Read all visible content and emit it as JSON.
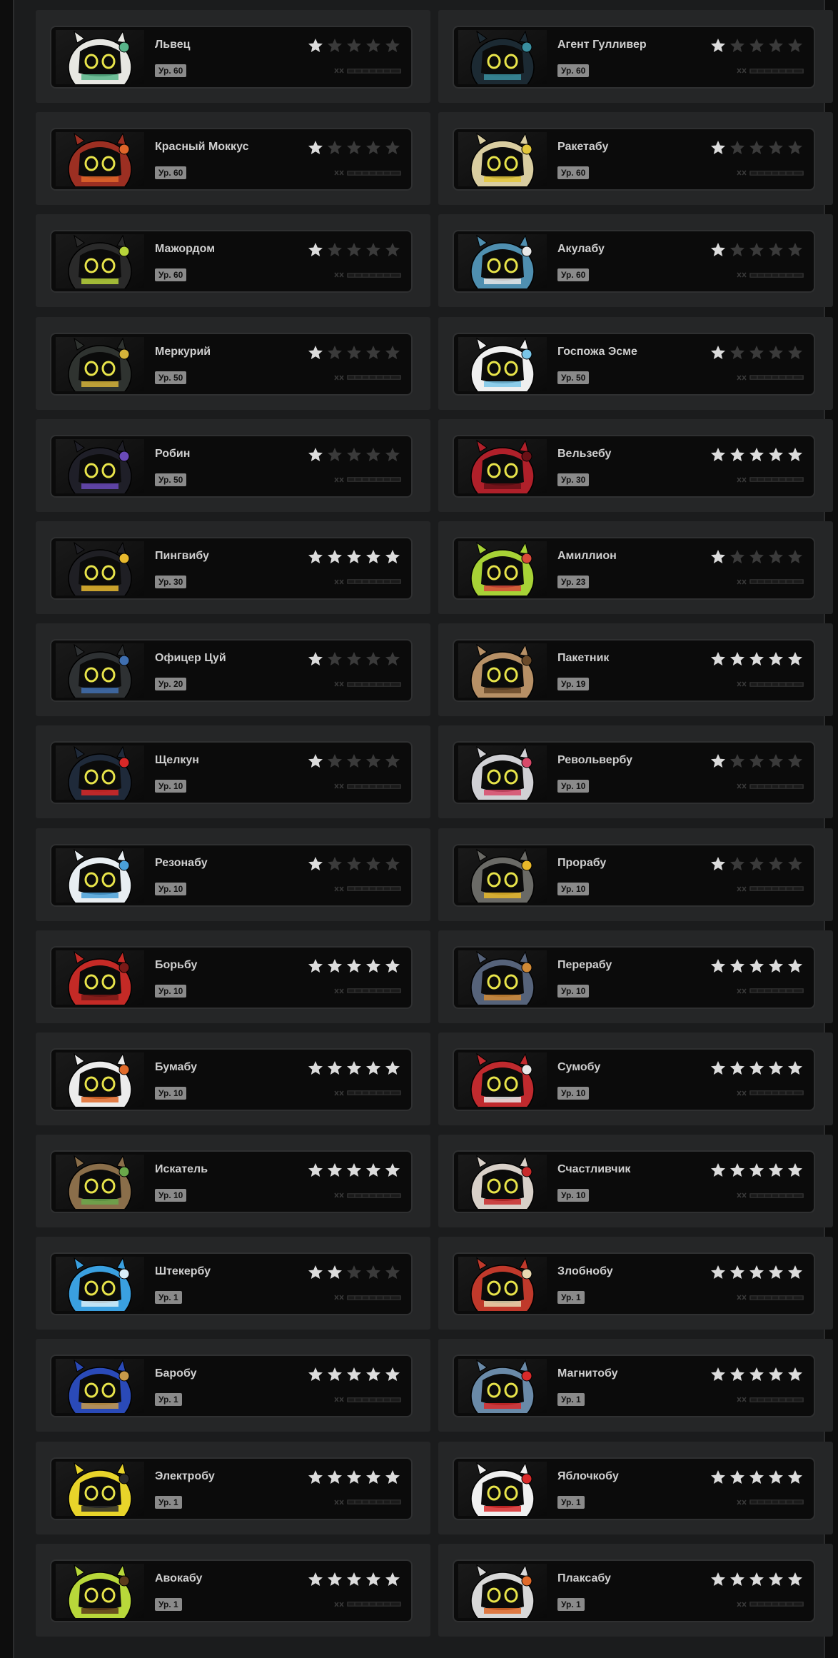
{
  "colors": {
    "background": "#0d0d0d",
    "panel": "#1b1c1d",
    "cell": "#252627",
    "card": "#0b0b0b",
    "star_filled": "#dcdcdc",
    "star_empty": "#3a3a3a",
    "level_badge": "#8a8a8a",
    "name_text": "#cfcfcf"
  },
  "bangboos": [
    {
      "name": "Львец",
      "level": "Ур. 60",
      "stars": 1,
      "icon": "bangboo-portrait-lvets",
      "body": "#e7e7e2",
      "accent": "#58b58a"
    },
    {
      "name": "Агент Гулливер",
      "level": "Ур. 60",
      "stars": 1,
      "icon": "bangboo-portrait-agent-gulliver",
      "body": "#1c2a33",
      "accent": "#3a8fa0"
    },
    {
      "name": "Красный Моккус",
      "level": "Ур. 60",
      "stars": 1,
      "icon": "bangboo-portrait-red-mokkus",
      "body": "#9c2f22",
      "accent": "#e0662a"
    },
    {
      "name": "Ракетабу",
      "level": "Ур. 60",
      "stars": 1,
      "icon": "bangboo-portrait-raketabu",
      "body": "#d9cda0",
      "accent": "#e2c63b"
    },
    {
      "name": "Мажордом",
      "level": "Ур. 60",
      "stars": 1,
      "icon": "bangboo-portrait-mazhordom",
      "body": "#2a2a2a",
      "accent": "#b7d43a"
    },
    {
      "name": "Акулабу",
      "level": "Ур. 60",
      "stars": 1,
      "icon": "bangboo-portrait-akulabu",
      "body": "#4f8fb0",
      "accent": "#e8e8e8"
    },
    {
      "name": "Меркурий",
      "level": "Ур. 50",
      "stars": 1,
      "icon": "bangboo-portrait-merkuriy",
      "body": "#2f3330",
      "accent": "#d6b43a"
    },
    {
      "name": "Госпожа Эсме",
      "level": "Ур. 50",
      "stars": 1,
      "icon": "bangboo-portrait-gospozha-esme",
      "body": "#efefef",
      "accent": "#7ac6e8"
    },
    {
      "name": "Робин",
      "level": "Ур. 50",
      "stars": 1,
      "icon": "bangboo-portrait-robin",
      "body": "#1f1f28",
      "accent": "#6a4ab8"
    },
    {
      "name": "Вельзебу",
      "level": "Ур. 30",
      "stars": 5,
      "icon": "bangboo-portrait-velzebu",
      "body": "#b0202a",
      "accent": "#6a1016"
    },
    {
      "name": "Пингвибу",
      "level": "Ур. 30",
      "stars": 5,
      "icon": "bangboo-portrait-pingvibu",
      "body": "#1f1f24",
      "accent": "#e8b92e"
    },
    {
      "name": "Амиллион",
      "level": "Ур. 23",
      "stars": 1,
      "icon": "bangboo-portrait-amillion",
      "body": "#a7d236",
      "accent": "#d84a3a"
    },
    {
      "name": "Офицер Цуй",
      "level": "Ур. 20",
      "stars": 1,
      "icon": "bangboo-portrait-ofitser-tsuy",
      "body": "#2e3133",
      "accent": "#3f6fb0"
    },
    {
      "name": "Пакетник",
      "level": "Ур. 19",
      "stars": 5,
      "icon": "bangboo-portrait-paketnik",
      "body": "#b79066",
      "accent": "#6a4a2a"
    },
    {
      "name": "Щелкун",
      "level": "Ур. 10",
      "stars": 1,
      "icon": "bangboo-portrait-shchelkun",
      "body": "#1f2a3a",
      "accent": "#d82828"
    },
    {
      "name": "Револьвербу",
      "level": "Ур. 10",
      "stars": 1,
      "icon": "bangboo-portrait-revolverbu",
      "body": "#d0d0d4",
      "accent": "#d84a6a"
    },
    {
      "name": "Резонабу",
      "level": "Ур. 10",
      "stars": 1,
      "icon": "bangboo-portrait-rezonabu",
      "body": "#e8eef2",
      "accent": "#4aa0d8"
    },
    {
      "name": "Прорабу",
      "level": "Ур. 10",
      "stars": 1,
      "icon": "bangboo-portrait-prorabu",
      "body": "#6a6a66",
      "accent": "#e8b82a"
    },
    {
      "name": "Борьбу",
      "level": "Ур. 10",
      "stars": 5,
      "icon": "bangboo-portrait-borbu",
      "body": "#c42a26",
      "accent": "#7a1a18"
    },
    {
      "name": "Перерабу",
      "level": "Ур. 10",
      "stars": 5,
      "icon": "bangboo-portrait-pererabu",
      "body": "#56637a",
      "accent": "#d08a36"
    },
    {
      "name": "Бумабу",
      "level": "Ур. 10",
      "stars": 5,
      "icon": "bangboo-portrait-bumabu",
      "body": "#ececec",
      "accent": "#e06a2a"
    },
    {
      "name": "Сумобу",
      "level": "Ур. 10",
      "stars": 5,
      "icon": "bangboo-portrait-sumobu",
      "body": "#c02a2e",
      "accent": "#e8e8e8"
    },
    {
      "name": "Искатель",
      "level": "Ур. 10",
      "stars": 5,
      "icon": "bangboo-portrait-iskatel",
      "body": "#8a6e4a",
      "accent": "#6aa84a"
    },
    {
      "name": "Счастливчик",
      "level": "Ур. 10",
      "stars": 5,
      "icon": "bangboo-portrait-schastlivchik",
      "body": "#d8d0c8",
      "accent": "#c82a2a"
    },
    {
      "name": "Штекербу",
      "level": "Ур. 1",
      "stars": 2,
      "icon": "bangboo-portrait-shtekerbu",
      "body": "#3aa0e0",
      "accent": "#d8eef8"
    },
    {
      "name": "Злобнобу",
      "level": "Ур. 1",
      "stars": 5,
      "icon": "bangboo-portrait-zlobnobu",
      "body": "#c0392b",
      "accent": "#e8d8b0"
    },
    {
      "name": "Баробу",
      "level": "Ур. 1",
      "stars": 5,
      "icon": "bangboo-portrait-barobu",
      "body": "#2a4ab8",
      "accent": "#c89a4a"
    },
    {
      "name": "Магнитобу",
      "level": "Ур. 1",
      "stars": 5,
      "icon": "bangboo-portrait-magnitobu",
      "body": "#6a8aa8",
      "accent": "#d82a2a"
    },
    {
      "name": "Электробу",
      "level": "Ур. 1",
      "stars": 5,
      "icon": "bangboo-portrait-elektrobu",
      "body": "#e8d42a",
      "accent": "#2a2a2a"
    },
    {
      "name": "Яблочкобу",
      "level": "Ур. 1",
      "stars": 5,
      "icon": "bangboo-portrait-yablochkobu",
      "body": "#f0f0f0",
      "accent": "#d82a2a"
    },
    {
      "name": "Авокабу",
      "level": "Ур. 1",
      "stars": 5,
      "icon": "bangboo-portrait-avokabu",
      "body": "#b8d83a",
      "accent": "#5a3a1a"
    },
    {
      "name": "Плаксабу",
      "level": "Ур. 1",
      "stars": 5,
      "icon": "bangboo-portrait-plaksabu",
      "body": "#d8d8d8",
      "accent": "#e06a2a"
    }
  ]
}
